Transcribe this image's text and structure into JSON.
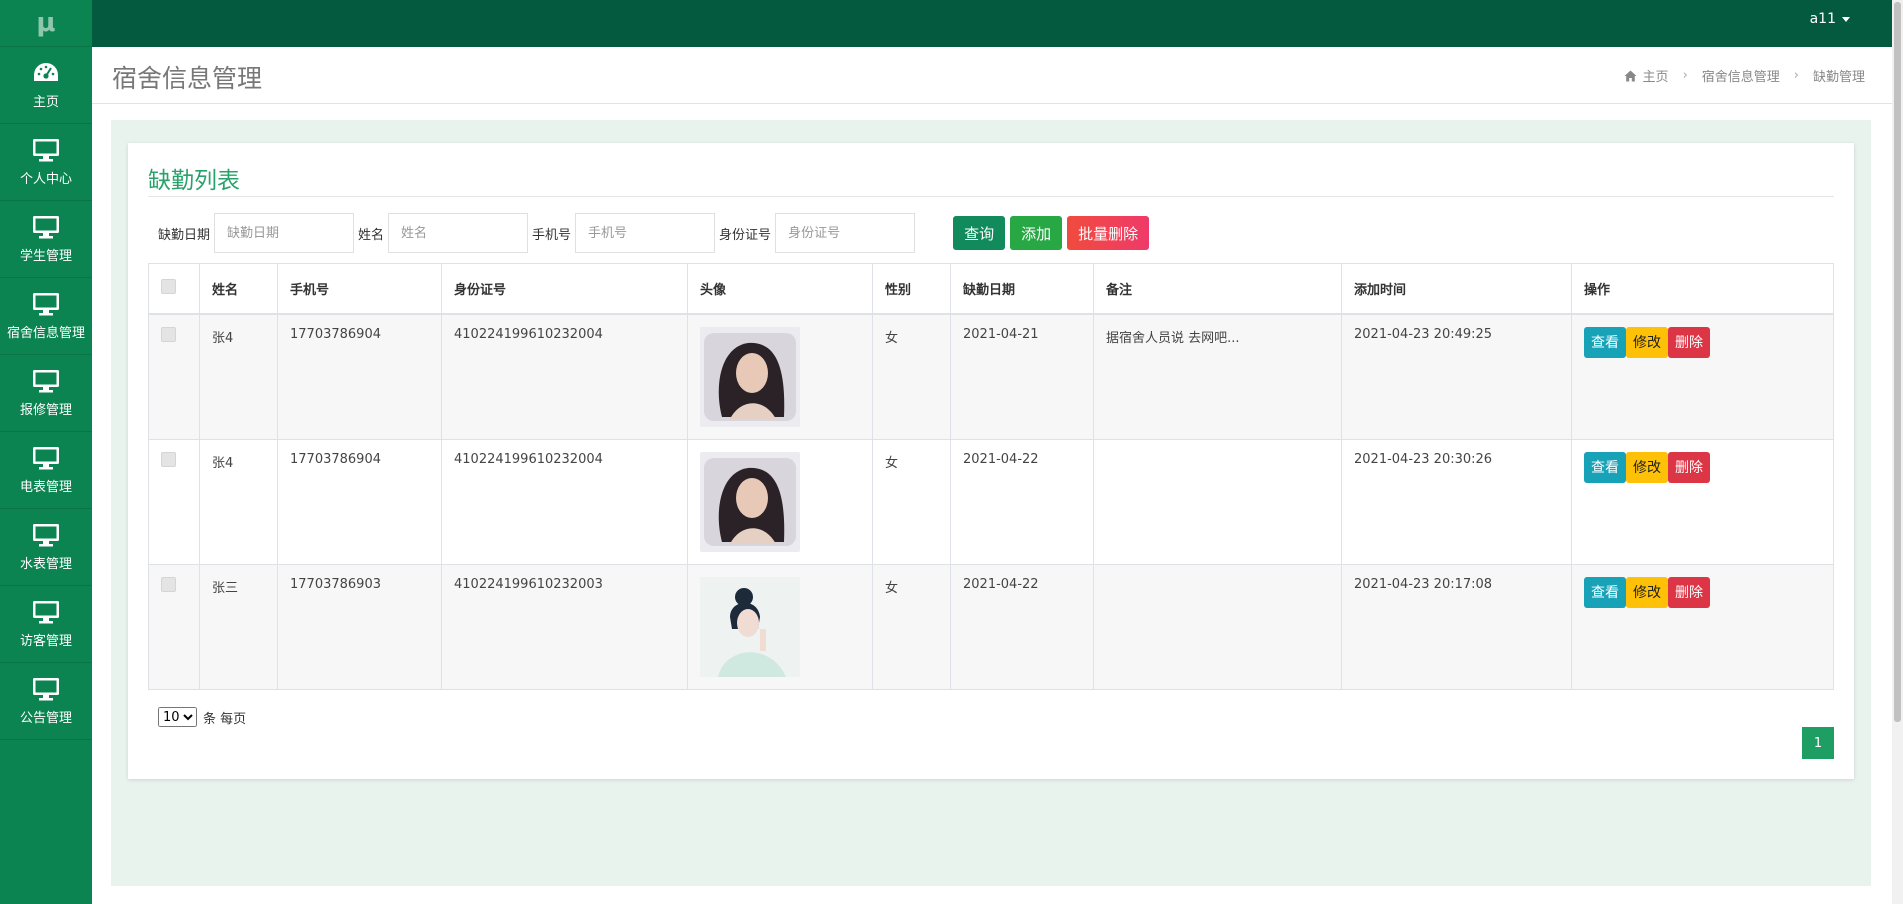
{
  "app": {
    "logo": "μ",
    "user": "a11"
  },
  "sidebar": {
    "items": [
      {
        "label": "主页",
        "icon": "dashboard-icon"
      },
      {
        "label": "个人中心",
        "icon": "monitor-icon"
      },
      {
        "label": "学生管理",
        "icon": "monitor-icon"
      },
      {
        "label": "宿舍信息管理",
        "icon": "monitor-icon"
      },
      {
        "label": "报修管理",
        "icon": "monitor-icon"
      },
      {
        "label": "电表管理",
        "icon": "monitor-icon"
      },
      {
        "label": "水表管理",
        "icon": "monitor-icon"
      },
      {
        "label": "访客管理",
        "icon": "monitor-icon"
      },
      {
        "label": "公告管理",
        "icon": "monitor-icon"
      }
    ]
  },
  "header": {
    "title": "宿舍信息管理",
    "breadcrumb": [
      "主页",
      "宿舍信息管理",
      "缺勤管理"
    ]
  },
  "panel": {
    "title": "缺勤列表"
  },
  "search": {
    "date_label": "缺勤日期",
    "date_placeholder": "缺勤日期",
    "name_label": "姓名",
    "name_placeholder": "姓名",
    "phone_label": "手机号",
    "phone_placeholder": "手机号",
    "id_label": "身份证号",
    "id_placeholder": "身份证号",
    "query_label": "查询",
    "add_label": "添加",
    "batch_delete_label": "批量删除"
  },
  "table": {
    "headers": [
      "姓名",
      "手机号",
      "身份证号",
      "头像",
      "性别",
      "缺勤日期",
      "备注",
      "添加时间",
      "操作"
    ],
    "rows": [
      {
        "name": "张4",
        "phone": "17703786904",
        "id_number": "410224199610232004",
        "gender": "女",
        "absence_date": "2021-04-21",
        "note": "据宿舍人员说 去网吧...",
        "added": "2021-04-23 20:49:25"
      },
      {
        "name": "张4",
        "phone": "17703786904",
        "id_number": "410224199610232004",
        "gender": "女",
        "absence_date": "2021-04-22",
        "note": "",
        "added": "2021-04-23 20:30:26"
      },
      {
        "name": "张三",
        "phone": "17703786903",
        "id_number": "410224199610232003",
        "gender": "女",
        "absence_date": "2021-04-22",
        "note": "",
        "added": "2021-04-23 20:17:08"
      }
    ],
    "actions": {
      "view": "查看",
      "edit": "修改",
      "delete": "删除"
    }
  },
  "pagination": {
    "page_size": "10",
    "page_size_options": [
      "10"
    ],
    "per_page_text": "条 每页",
    "current_page": "1"
  },
  "colors": {
    "topbar": "#035a3f",
    "sidebar": "#0c8451",
    "accent": "#2aa36b"
  }
}
